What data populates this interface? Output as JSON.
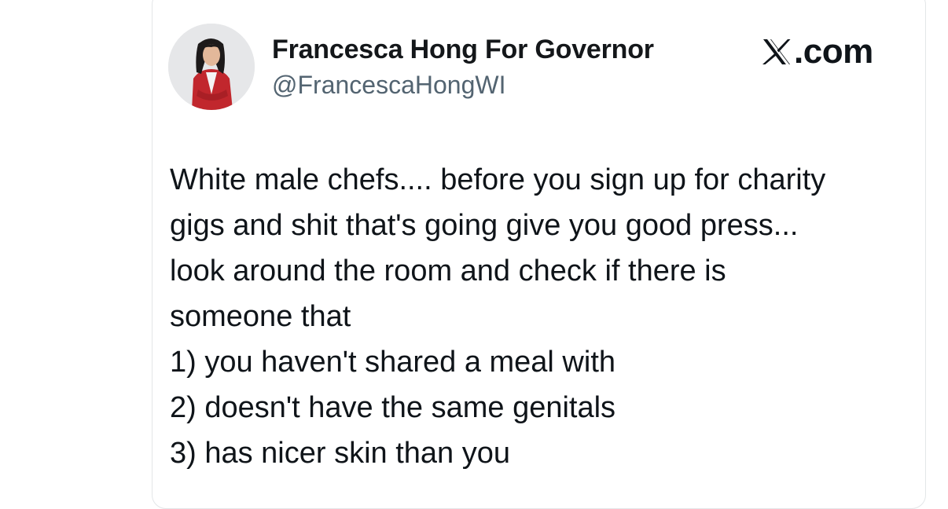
{
  "tweet": {
    "author_name": "Francesca Hong For Governor",
    "author_handle": "@FrancescaHongWI",
    "brand": ".com",
    "brand_icon": "x-logo-icon",
    "lines": [
      "White male chefs.... before you sign up for charity",
      "gigs and shit that's going give you good press...",
      "look around the room and check if there is",
      "someone that",
      "1) you haven't shared a meal with",
      "2) doesn't have the same genitals",
      "3) has nicer skin than you"
    ]
  },
  "colors": {
    "text": "#0f1419",
    "muted": "#536471",
    "border": "#e3e6e8",
    "jacket": "#c1272d"
  }
}
